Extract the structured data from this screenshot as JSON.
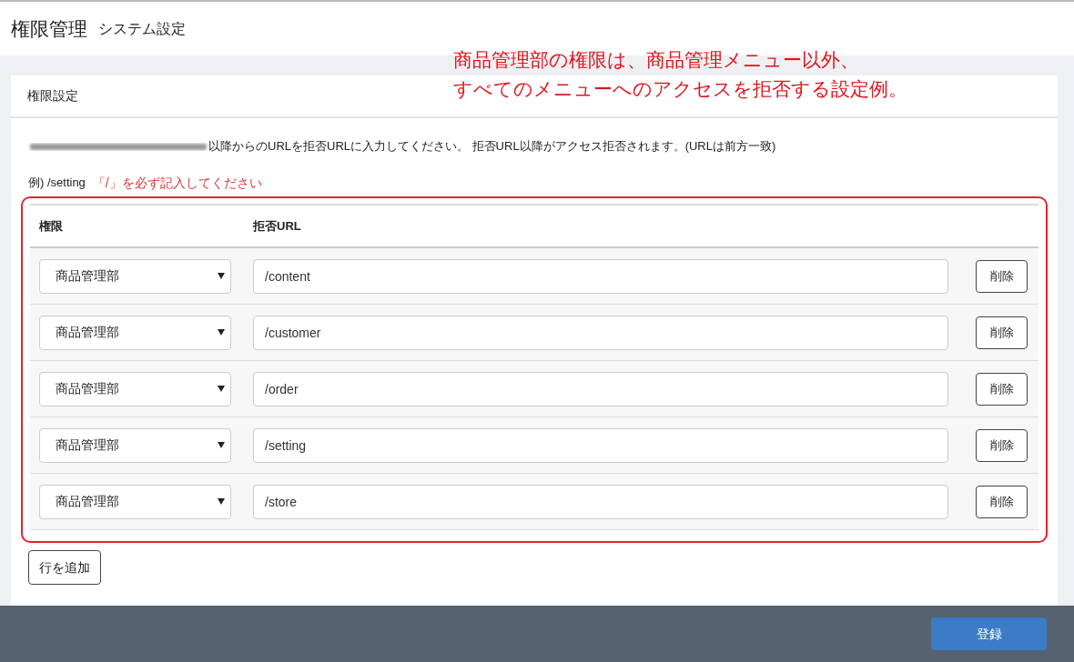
{
  "header": {
    "title": "権限管理",
    "subtitle": "システム設定"
  },
  "annotation": [
    "商品管理部の権限は、商品管理メニュー以外、",
    "すべてのメニューへのアクセスを拒否する設定例。"
  ],
  "card": {
    "title": "権限設定",
    "instruction": "以降からのURLを拒否URLに入力してください。 拒否URL以降がアクセス拒否されます。(URLは前方一致)",
    "example": "例) /setting",
    "example_note": "「/」を必ず記入してください"
  },
  "table": {
    "columns": [
      "権限",
      "拒否URL"
    ],
    "rows": [
      {
        "role": "商品管理部",
        "url": "/content",
        "delete": "削除"
      },
      {
        "role": "商品管理部",
        "url": "/customer",
        "delete": "削除"
      },
      {
        "role": "商品管理部",
        "url": "/order",
        "delete": "削除"
      },
      {
        "role": "商品管理部",
        "url": "/setting",
        "delete": "削除"
      },
      {
        "role": "商品管理部",
        "url": "/store",
        "delete": "削除"
      }
    ]
  },
  "add_row_button": "行を追加",
  "footer": {
    "submit": "登録"
  }
}
